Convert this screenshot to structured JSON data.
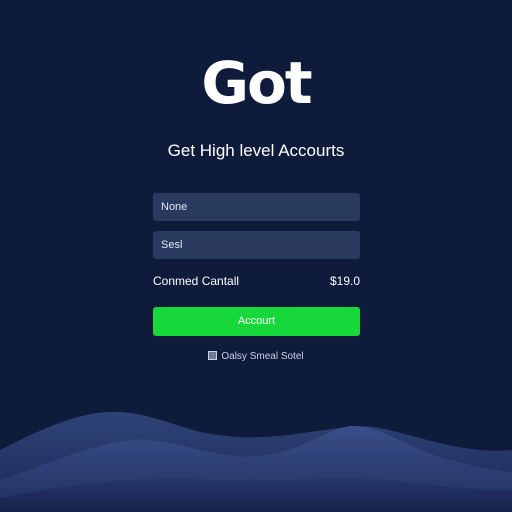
{
  "brand": {
    "logo_text": "Got"
  },
  "headline": "Get High level Accourts",
  "form": {
    "name_placeholder": "None",
    "seal_placeholder": "Sesl",
    "summary_label": "Conmed Cantall",
    "summary_price": "$19.0",
    "submit_label": "Accourt",
    "note_text": "Oalsy Smeal Sotel"
  },
  "colors": {
    "background": "#0f1b3a",
    "field": "#2a3a5e",
    "accent": "#16d83a"
  }
}
